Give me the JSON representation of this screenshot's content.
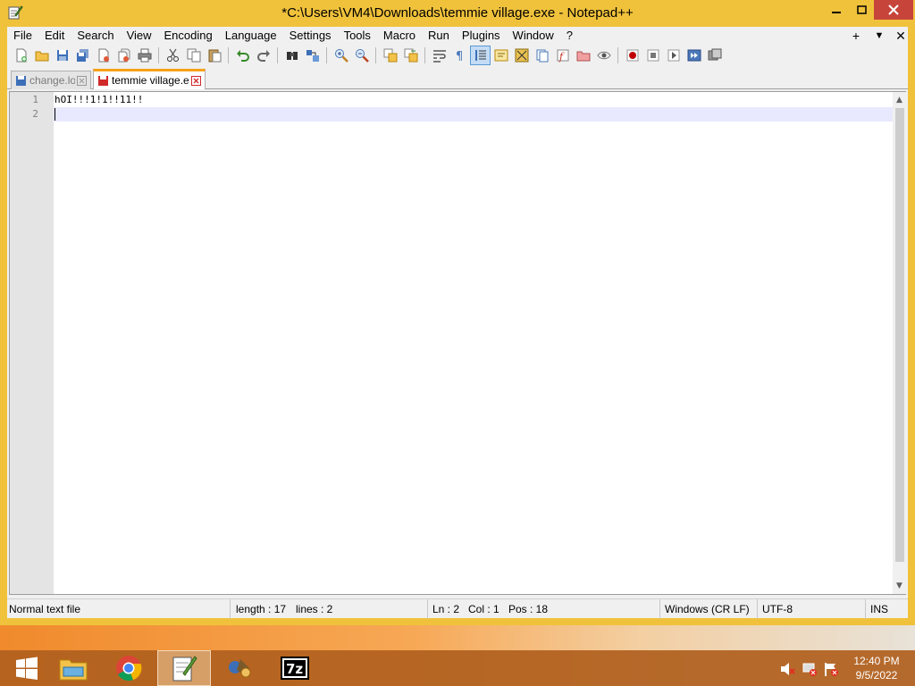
{
  "window": {
    "title": "*C:\\Users\\VM4\\Downloads\\temmie village.exe - Notepad++",
    "accent_color": "#f0c23b"
  },
  "menu": {
    "items": [
      "File",
      "Edit",
      "Search",
      "View",
      "Encoding",
      "Language",
      "Settings",
      "Tools",
      "Macro",
      "Run",
      "Plugins",
      "Window",
      "?"
    ],
    "right": [
      "+",
      "▼",
      "✕"
    ]
  },
  "tabs": [
    {
      "label": "change.log",
      "state": "inactive"
    },
    {
      "label": "temmie village.exe",
      "state": "active-modified"
    }
  ],
  "editor": {
    "line_numbers": [
      "1",
      "2"
    ],
    "lines": [
      "hOI!!!1!1!!11!!",
      ""
    ]
  },
  "status": {
    "file_type": "Normal text file",
    "length": "length : 17",
    "lines": "lines : 2",
    "ln": "Ln : 2",
    "col": "Col : 1",
    "pos": "Pos : 18",
    "eol": "Windows (CR LF)",
    "encoding": "UTF-8",
    "mode": "INS"
  },
  "taskbar": {
    "apps": [
      "windows-start",
      "file-explorer",
      "chrome",
      "notepad-plus-plus",
      "paint-tool",
      "7-zip"
    ],
    "time": "12:40 PM",
    "date": "9/5/2022"
  }
}
